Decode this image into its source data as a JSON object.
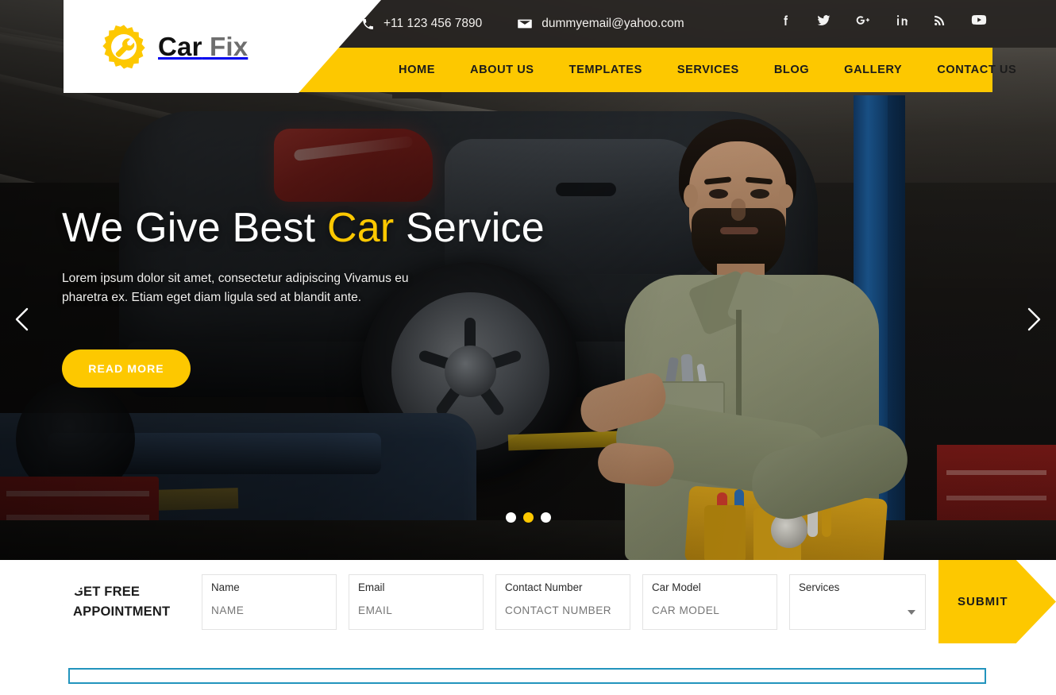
{
  "brand": {
    "name_first": "Car",
    "name_second": "Fix",
    "logo_icon": "gear-wrench-icon",
    "accent_color": "#fdc800",
    "dark_color": "#262320"
  },
  "topbar": {
    "phone": "+11 123 456 7890",
    "phone_icon": "phone-icon",
    "email": "dummyemail@yahoo.com",
    "email_icon": "envelope-icon",
    "social": [
      {
        "name": "facebook-icon",
        "label": "f"
      },
      {
        "name": "twitter-icon",
        "label": "t"
      },
      {
        "name": "google-plus-icon",
        "label": "G+"
      },
      {
        "name": "linkedin-icon",
        "label": "in"
      },
      {
        "name": "rss-icon",
        "label": "rss"
      },
      {
        "name": "youtube-icon",
        "label": "yt"
      }
    ]
  },
  "nav": {
    "items": [
      {
        "label": "HOME",
        "active": true
      },
      {
        "label": "ABOUT US",
        "active": false
      },
      {
        "label": "TEMPLATES",
        "active": false
      },
      {
        "label": "SERVICES",
        "active": false
      },
      {
        "label": "BLOG",
        "active": false
      },
      {
        "label": "GALLERY",
        "active": false
      },
      {
        "label": "CONTACT US",
        "active": false
      }
    ]
  },
  "hero": {
    "title_part1": "We Give Best ",
    "title_accent": "Car",
    "title_part2": " Service",
    "subtitle": "Lorem ipsum dolor sit amet, consectetur adipiscing Vivamus eu pharetra ex. Etiam eget diam ligula sed at blandit ante.",
    "button_label": "READ MORE",
    "prev_icon": "chevron-left-icon",
    "next_icon": "chevron-right-icon",
    "slides_total": 3,
    "active_slide": 2
  },
  "appointment": {
    "title": "GET FREE APPOINTMENT",
    "fields": [
      {
        "label": "Name",
        "placeholder": "NAME",
        "value": "",
        "type": "text"
      },
      {
        "label": "Email",
        "placeholder": "EMAIL",
        "value": "",
        "type": "text"
      },
      {
        "label": "Contact Number",
        "placeholder": "CONTACT NUMBER",
        "value": "",
        "type": "text"
      },
      {
        "label": "Car Model",
        "placeholder": "CAR MODEL",
        "value": "",
        "type": "text"
      },
      {
        "label": "Services",
        "placeholder": "",
        "value": "",
        "type": "select"
      }
    ],
    "submit_label": "SUBMIT"
  },
  "bottom_bar": {
    "border_color": "#2294bd"
  }
}
